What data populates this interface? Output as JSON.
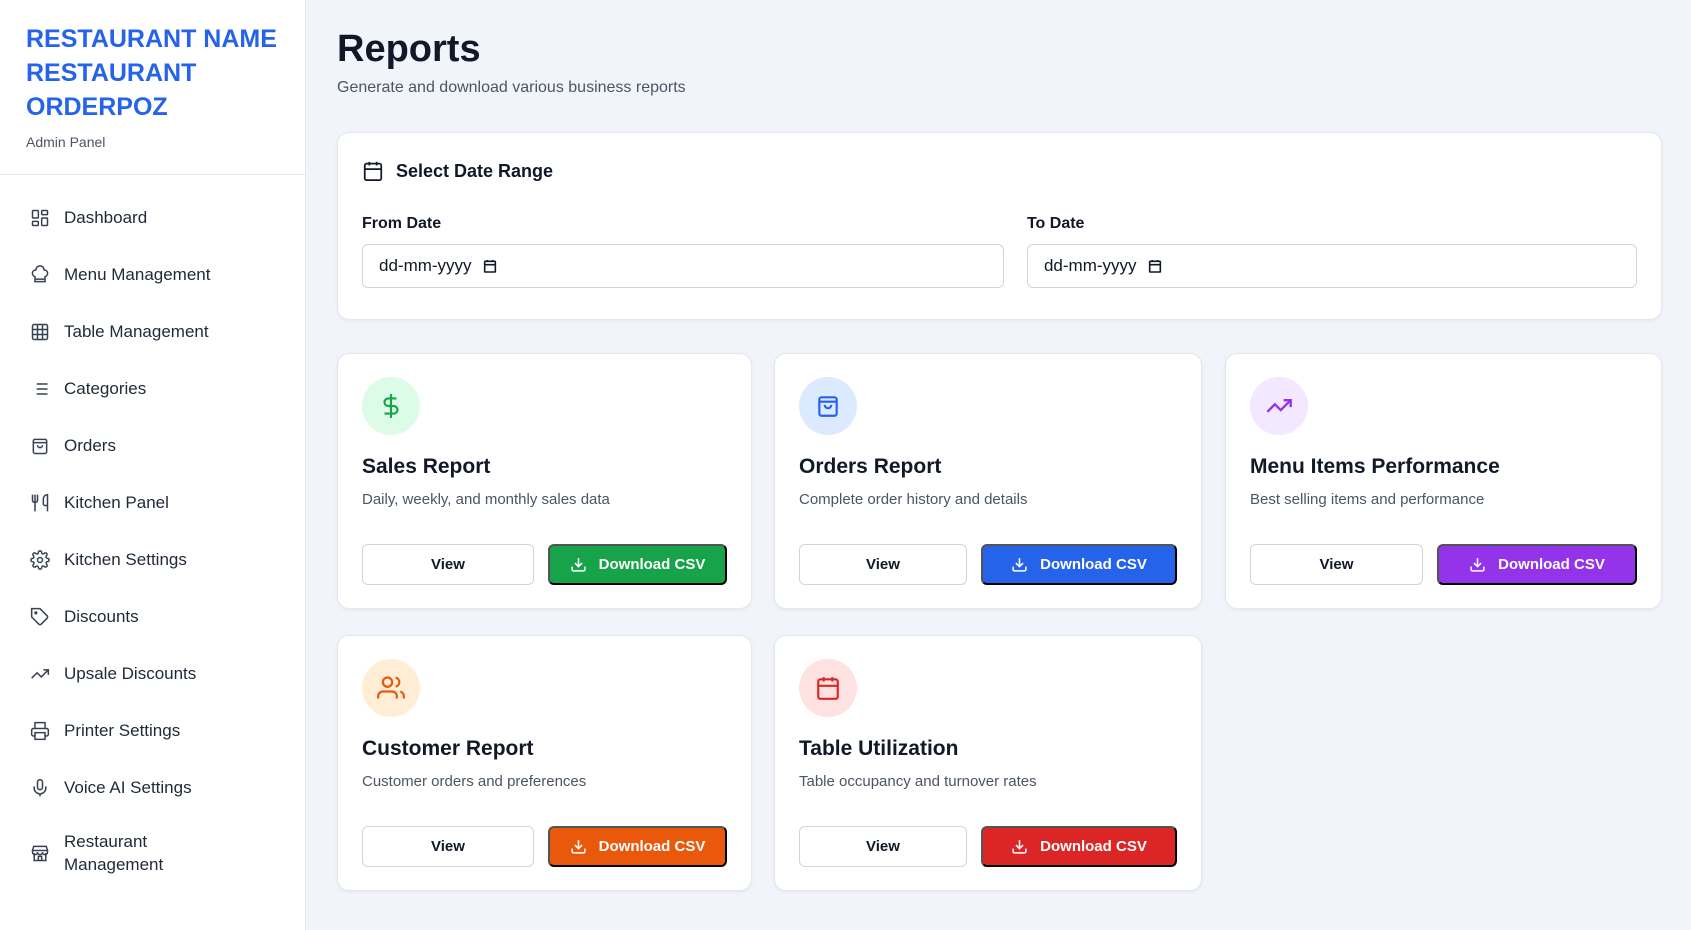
{
  "brand": {
    "name": "RESTAURANT NAME RESTAURANT ORDERPOZ",
    "subtitle": "Admin Panel"
  },
  "sidebar": {
    "items": [
      {
        "label": "Dashboard",
        "icon": "grid-icon"
      },
      {
        "label": "Menu Management",
        "icon": "chef-hat-icon"
      },
      {
        "label": "Table Management",
        "icon": "table-grid-icon"
      },
      {
        "label": "Categories",
        "icon": "list-icon"
      },
      {
        "label": "Orders",
        "icon": "shopping-bag-icon"
      },
      {
        "label": "Kitchen Panel",
        "icon": "utensils-icon"
      },
      {
        "label": "Kitchen Settings",
        "icon": "gear-icon"
      },
      {
        "label": "Discounts",
        "icon": "tag-icon"
      },
      {
        "label": "Upsale Discounts",
        "icon": "trending-up-icon"
      },
      {
        "label": "Printer Settings",
        "icon": "printer-icon"
      },
      {
        "label": "Voice AI Settings",
        "icon": "microphone-icon"
      },
      {
        "label": "Restaurant Management",
        "icon": "store-icon"
      }
    ]
  },
  "page": {
    "title": "Reports",
    "subtitle": "Generate and download various business reports"
  },
  "date_range": {
    "heading": "Select Date Range",
    "from_label": "From Date",
    "from_value": "dd-mm-yyyy",
    "to_label": "To Date",
    "to_value": "dd-mm-yyyy"
  },
  "reports": [
    {
      "title": "Sales Report",
      "description": "Daily, weekly, and monthly sales data",
      "view_label": "View",
      "download_label": "Download CSV",
      "icon": "dollar-icon",
      "accent": "#16a34a",
      "icon_bg": "#dcfce7"
    },
    {
      "title": "Orders Report",
      "description": "Complete order history and details",
      "view_label": "View",
      "download_label": "Download CSV",
      "icon": "shopping-bag-icon",
      "accent": "#2563eb",
      "icon_bg": "#dbeafe"
    },
    {
      "title": "Menu Items Performance",
      "description": "Best selling items and performance",
      "view_label": "View",
      "download_label": "Download CSV",
      "icon": "trending-up-icon",
      "accent": "#9333ea",
      "icon_bg": "#f3e8ff"
    },
    {
      "title": "Customer Report",
      "description": "Customer orders and preferences",
      "view_label": "View",
      "download_label": "Download CSV",
      "icon": "users-icon",
      "accent": "#ea580c",
      "icon_bg": "#ffedd5"
    },
    {
      "title": "Table Utilization",
      "description": "Table occupancy and turnover rates",
      "view_label": "View",
      "download_label": "Download CSV",
      "icon": "calendar-icon",
      "accent": "#dc2626",
      "icon_bg": "#fee2e2"
    }
  ]
}
